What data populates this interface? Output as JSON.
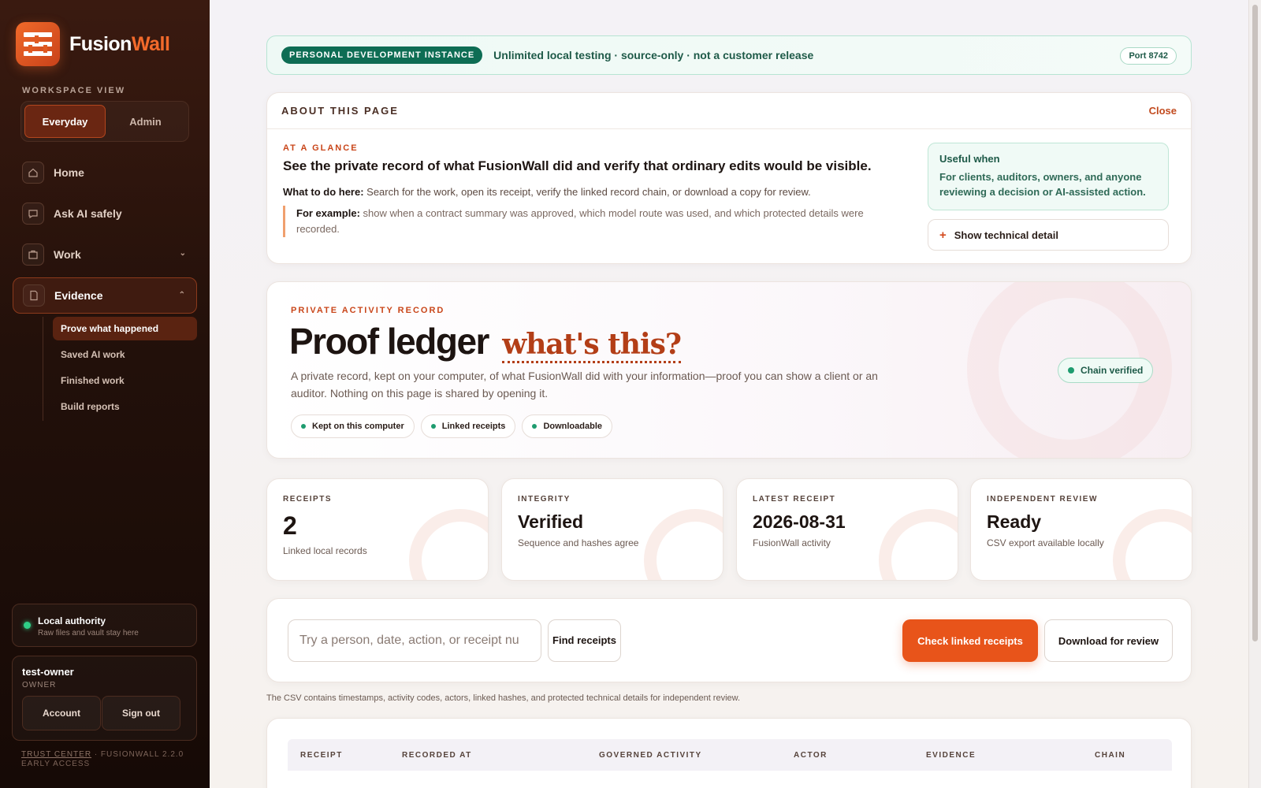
{
  "sidebar": {
    "brand": {
      "name_part1": "Fusion",
      "name_part2": "Wall"
    },
    "workspace_label": "WORKSPACE VIEW",
    "workspace_options": [
      "Everyday",
      "Admin"
    ],
    "nav": [
      {
        "label": "Home",
        "icon": "home-icon"
      },
      {
        "label": "Ask AI safely",
        "icon": "chat-icon"
      },
      {
        "label": "Work",
        "icon": "folder-icon"
      },
      {
        "label": "Evidence",
        "icon": "document-icon"
      }
    ],
    "sub_nav": [
      "Prove what happened",
      "Saved AI work",
      "Finished work",
      "Build reports"
    ],
    "authority": {
      "title": "Local authority",
      "subtitle": "Raw files and vault stay here"
    },
    "user": {
      "name": "test-owner",
      "role": "OWNER",
      "account": "Account",
      "signout": "Sign out"
    },
    "footer": {
      "link": "TRUST CENTER",
      "version": " · FUSIONWALL 2.2.0 EARLY ACCESS"
    }
  },
  "banner": {
    "badge": "PERSONAL DEVELOPMENT INSTANCE",
    "text": "Unlimited local testing · source-only · not a customer release",
    "port": "Port 8742"
  },
  "about": {
    "title": "ABOUT THIS PAGE",
    "close": "Close",
    "glance_label": "AT A GLANCE",
    "headline": "See the private record of what FusionWall did and verify that ordinary edits would be visible.",
    "todo_label": "What to do here:",
    "todo_text": " Search for the work, open its receipt, verify the linked record chain, or download a copy for review.",
    "example_label": "For example:",
    "example_text": " show when a contract summary was approved, which model route was used, and which protected details were recorded.",
    "useful_title": "Useful when",
    "useful_body": "For clients, auditors, owners, and anyone reviewing a decision or AI-assisted action.",
    "tech_button": "Show technical detail"
  },
  "hero": {
    "label": "PRIVATE ACTIVITY RECORD",
    "title": "Proof ledger",
    "whats_this": "what's this?",
    "description": "A private record, kept on your computer, of what FusionWall did with your information—proof you can show a client or an auditor. Nothing on this page is shared by opening it.",
    "chips": [
      "Kept on this computer",
      "Linked receipts",
      "Downloadable"
    ],
    "status": "Chain verified"
  },
  "stats": [
    {
      "label": "RECEIPTS",
      "value": "2",
      "sub": "Linked local records"
    },
    {
      "label": "INTEGRITY",
      "value": "Verified",
      "sub": "Sequence and hashes agree"
    },
    {
      "label": "LATEST RECEIPT",
      "value": "2026-08-31",
      "sub": "FusionWall activity"
    },
    {
      "label": "INDEPENDENT REVIEW",
      "value": "Ready",
      "sub": "CSV export available locally"
    }
  ],
  "search": {
    "placeholder": "Try a person, date, action, or receipt nu",
    "find": "Find receipts",
    "check": "Check linked receipts",
    "download": "Download for review",
    "note": "The CSV contains timestamps, activity codes, actors, linked hashes, and protected technical details for independent review."
  },
  "table": {
    "columns": [
      "RECEIPT",
      "RECORDED AT",
      "GOVERNED ACTIVITY",
      "ACTOR",
      "EVIDENCE",
      "CHAIN"
    ]
  },
  "colors": {
    "accent": "#e8541a",
    "brand_dark": "#22100a",
    "success": "#1e9c6f"
  }
}
